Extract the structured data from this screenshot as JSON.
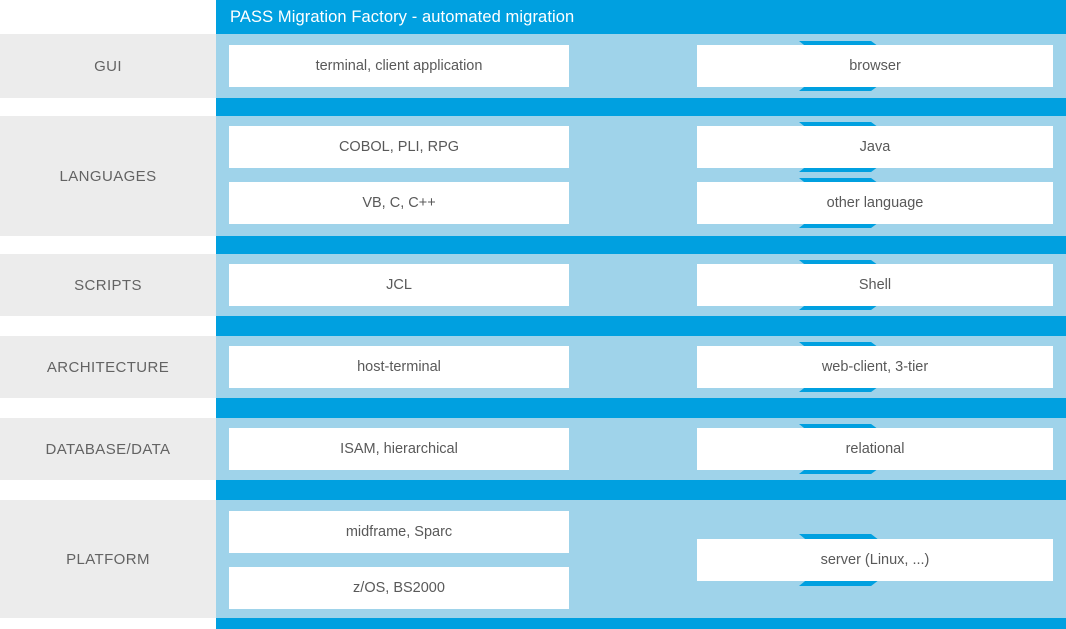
{
  "header": {
    "title": "PASS Migration Factory - automated migration"
  },
  "colors": {
    "title_bar": "#00a0e0",
    "accent_blue": "#00a0e0",
    "panel_blue": "#9fd3ea",
    "category_gray": "#ececec",
    "box_white": "#ffffff",
    "text_gray": "#595959"
  },
  "icons": {
    "arrow": "gears-arrow-icon"
  },
  "rows": [
    {
      "category": "GUI",
      "source": [
        "terminal, client application"
      ],
      "target": [
        "browser"
      ]
    },
    {
      "category": "LANGUAGES",
      "source": [
        "COBOL, PLI, RPG",
        "VB, C, C++"
      ],
      "target": [
        "Java",
        "other language"
      ]
    },
    {
      "category": "SCRIPTS",
      "source": [
        "JCL"
      ],
      "target": [
        "Shell"
      ]
    },
    {
      "category": "ARCHITECTURE",
      "source": [
        "host-terminal"
      ],
      "target": [
        "web-client, 3-tier"
      ]
    },
    {
      "category": "DATABASE/DATA",
      "source": [
        "ISAM, hierarchical"
      ],
      "target": [
        "relational"
      ]
    },
    {
      "category": "PLATFORM",
      "source": [
        "midframe, Sparc",
        "z/OS, BS2000"
      ],
      "target": [
        "server (Linux, ...)"
      ]
    }
  ]
}
